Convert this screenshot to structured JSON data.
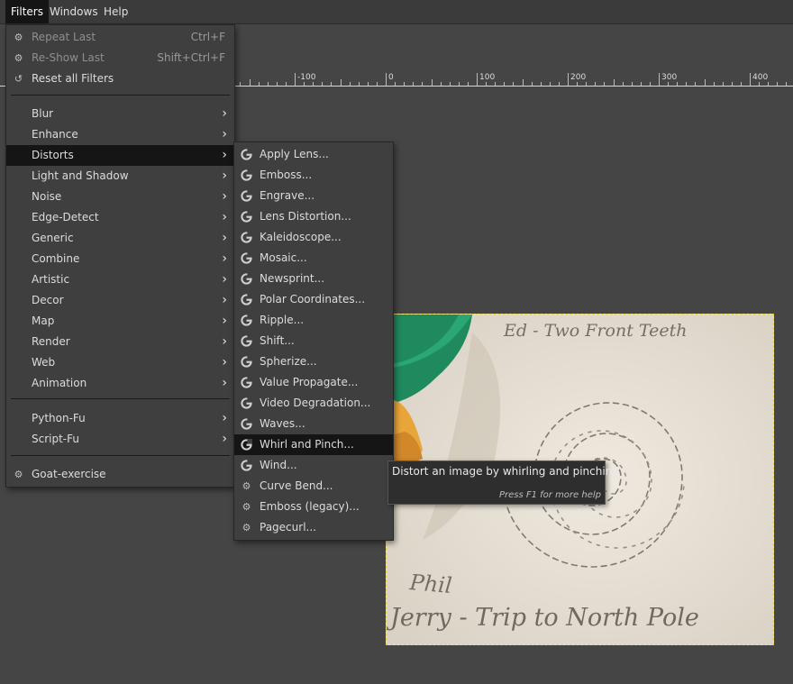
{
  "menubar": {
    "filters": "Filters",
    "windows": "Windows",
    "help": "Help"
  },
  "ruler": {
    "labels": [
      "-100",
      "0",
      "100",
      "200",
      "300",
      "400"
    ]
  },
  "filters_menu": {
    "repeat_last": "Repeat Last",
    "repeat_last_sc": "Ctrl+F",
    "reshow_last": "Re-Show Last",
    "reshow_last_sc": "Shift+Ctrl+F",
    "reset_all": "Reset all Filters",
    "items": [
      "Blur",
      "Enhance",
      "Distorts",
      "Light and Shadow",
      "Noise",
      "Edge-Detect",
      "Generic",
      "Combine",
      "Artistic",
      "Decor",
      "Map",
      "Render",
      "Web",
      "Animation"
    ],
    "python_fu": "Python-Fu",
    "script_fu": "Script-Fu",
    "goat": "Goat-exercise"
  },
  "distorts_menu": {
    "items": [
      "Apply Lens...",
      "Emboss...",
      "Engrave...",
      "Lens Distortion...",
      "Kaleidoscope...",
      "Mosaic...",
      "Newsprint...",
      "Polar Coordinates...",
      "Ripple...",
      "Shift...",
      "Spherize...",
      "Value Propagate...",
      "Video Degradation...",
      "Waves...",
      "Whirl and Pinch...",
      "Wind..."
    ],
    "legacy": [
      "Curve Bend...",
      "Emboss (legacy)...",
      "Pagecurl..."
    ]
  },
  "tooltip": {
    "text": "Distort an image by whirling and pinching",
    "help": "Press F1 for more help"
  },
  "image": {
    "text1": "Ed - Two Front Teeth",
    "text2": "Phil",
    "text3": "Jerry -  Trip to North Pole"
  }
}
